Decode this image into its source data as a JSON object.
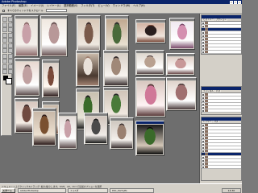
{
  "window": {
    "title": "Adobe Photoshop"
  },
  "menubar": {
    "items": [
      "ファイル(F)",
      "編集(E)",
      "イメージ(I)",
      "レイヤー(L)",
      "選択範囲(S)",
      "フィルタ(T)",
      "ビュー(V)",
      "ウィンドウ(W)",
      "ヘルプ(H)"
    ]
  },
  "optionsbar": {
    "label": "すべてのウィンドウをスクロール"
  },
  "colors": {
    "accent": "#0a246a",
    "chrome": "#d4d0c8",
    "workspace": "#6e6e6e"
  },
  "documents": [
    {
      "name": "photo-1",
      "palette": [
        "#e8e0d8",
        "#c8a0a8",
        "#f4f0ec",
        "#8c6a6a"
      ]
    },
    {
      "name": "photo-2",
      "palette": [
        "#f0e8e0",
        "#b89898",
        "#ffffff",
        "#6a5454"
      ]
    },
    {
      "name": "photo-3",
      "palette": [
        "#d8c8b8",
        "#7a5a4a",
        "#efe8e0",
        "#3a2a2a"
      ]
    },
    {
      "name": "photo-4",
      "palette": [
        "#c0a890",
        "#4a6a3a",
        "#e8e0d0",
        "#2a2a2a"
      ]
    },
    {
      "name": "photo-5",
      "palette": [
        "#d4b4a4",
        "#2a1e1e",
        "#f0e4dc",
        "#7a4a3a"
      ]
    },
    {
      "name": "photo-6",
      "palette": [
        "#f0e8f0",
        "#d490b0",
        "#ffffff",
        "#7a4a6a"
      ]
    },
    {
      "name": "photo-7",
      "palette": [
        "#e8d8d0",
        "#c0a0a0",
        "#ffffff",
        "#605050"
      ]
    },
    {
      "name": "photo-8",
      "palette": [
        "#ddd0c8",
        "#7a4a3a",
        "#fff8f0",
        "#2a1a1a"
      ]
    },
    {
      "name": "photo-9",
      "palette": [
        "#c8b8a8",
        "#e8e0d8",
        "#4a3a30",
        "#a08070"
      ]
    },
    {
      "name": "photo-10",
      "palette": [
        "#d8d0c8",
        "#a08878",
        "#f8f4f0",
        "#3a3030"
      ]
    },
    {
      "name": "photo-11",
      "palette": [
        "#e0d8d0",
        "#b8a090",
        "#ffffff",
        "#504040"
      ]
    },
    {
      "name": "photo-12",
      "palette": [
        "#e0d0c8",
        "#c89898",
        "#ffffff",
        "#6a4a4a"
      ]
    },
    {
      "name": "photo-13",
      "palette": [
        "#d8c8c0",
        "#704a40",
        "#f4ece4",
        "#3a2a2a"
      ]
    },
    {
      "name": "photo-14",
      "palette": [
        "#c8b8a8",
        "#382820",
        "#e8dcd0",
        "#8a6a5a"
      ]
    },
    {
      "name": "photo-15",
      "palette": [
        "#c8c0b0",
        "#3a6a2a",
        "#e8e4d8",
        "#202020"
      ]
    },
    {
      "name": "photo-16",
      "palette": [
        "#d0c4b8",
        "#4a7a3a",
        "#f0e8e0",
        "#282828"
      ]
    },
    {
      "name": "photo-17",
      "palette": [
        "#d8c8c0",
        "#d07898",
        "#fff4f4",
        "#5a3a3a"
      ]
    },
    {
      "name": "photo-18",
      "palette": [
        "#e0d4cc",
        "#a07070",
        "#ffffff",
        "#4a3a3a"
      ]
    },
    {
      "name": "photo-19",
      "palette": [
        "#d8ccc4",
        "#6a5a50",
        "#f4ece4",
        "#2a2020"
      ]
    },
    {
      "name": "photo-20",
      "palette": [
        "#c8b8a8",
        "#7a5030",
        "#ece0d0",
        "#2a1a1a"
      ]
    },
    {
      "name": "photo-21",
      "palette": [
        "#e4dcd8",
        "#c8a0a8",
        "#ffffff",
        "#5a4a4a"
      ]
    },
    {
      "name": "photo-22",
      "palette": [
        "#d0c4bc",
        "#4a4a4a",
        "#f0ece8",
        "#1a1a1a"
      ]
    },
    {
      "name": "photo-23",
      "palette": [
        "#d0c8c0",
        "#9a8070",
        "#f4f0ec",
        "#3a3030"
      ]
    },
    {
      "name": "photo-24",
      "palette": [
        "#1a1a1a",
        "#3a6a2a",
        "#d4c8b8",
        "#0a0a0a"
      ]
    }
  ],
  "panels": {
    "layers_tabs": [
      "ヒストリー",
      "アクション"
    ],
    "channels_tabs": [
      "チャンネル",
      "パス"
    ],
    "layers2_tabs": [
      "レイヤー",
      "パス"
    ]
  },
  "statusbar": {
    "text": "ドキュメント上でクリック&ドラッグ: 拡大/縮小します。Shift、Alt、Ctrl で追加オプションを選択"
  },
  "taskbar": {
    "start": "スタート",
    "tasks": [
      "Adobe Photoshop",
      "フォルダ",
      "DSC_0123.JPG"
    ],
    "clock": "14:30"
  }
}
